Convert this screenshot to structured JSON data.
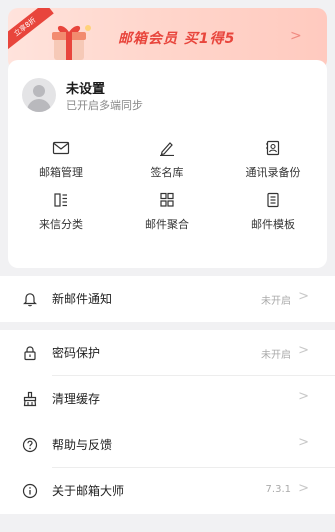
{
  "promo": {
    "tag": "立享8折",
    "text": "邮箱会员 买1得5",
    "arrow": ">"
  },
  "profile": {
    "name": "未设置",
    "subtitle": "已开启多端同步"
  },
  "tools": [
    {
      "label": "邮箱管理",
      "icon": "envelope-icon"
    },
    {
      "label": "签名库",
      "icon": "pen-icon"
    },
    {
      "label": "通讯录备份",
      "icon": "contact-card-icon"
    },
    {
      "label": "来信分类",
      "icon": "columns-icon"
    },
    {
      "label": "邮件聚合",
      "icon": "grid-icon"
    },
    {
      "label": "邮件模板",
      "icon": "template-icon"
    }
  ],
  "settings": {
    "notify": {
      "label": "新邮件通知",
      "value": "未开启",
      "icon": "bell-icon"
    },
    "password": {
      "label": "密码保护",
      "value": "未开启",
      "icon": "lock-icon"
    },
    "cache": {
      "label": "清理缓存",
      "value": "",
      "icon": "broom-icon"
    },
    "help": {
      "label": "帮助与反馈",
      "value": "",
      "icon": "question-icon"
    },
    "about": {
      "label": "关于邮箱大师",
      "value": "7.3.1",
      "icon": "info-icon"
    }
  },
  "chevron": ">"
}
